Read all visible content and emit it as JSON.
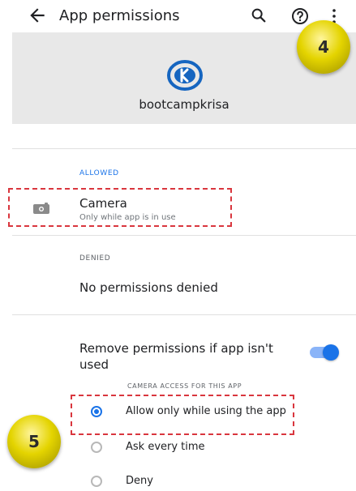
{
  "topbar": {
    "title": "App permissions",
    "icons": [
      "back-arrow-icon",
      "search-icon",
      "help-icon",
      "more-vert-icon"
    ]
  },
  "app": {
    "name": "bootcampkrisa",
    "logo_letter": "K",
    "logo_color": "#1565c0"
  },
  "allowed": {
    "label": "ALLOWED",
    "items": [
      {
        "title": "Camera",
        "subtitle": "Only while app is in use",
        "icon": "camera-icon"
      }
    ]
  },
  "denied": {
    "label": "DENIED",
    "empty_text": "No permissions denied"
  },
  "remove_permissions": {
    "text": "Remove permissions if app isn't used",
    "enabled": true
  },
  "camera_access": {
    "label": "CAMERA ACCESS FOR THIS APP",
    "options": [
      {
        "label": "Allow only while using the app",
        "selected": true
      },
      {
        "label": "Ask every time",
        "selected": false
      },
      {
        "label": "Deny",
        "selected": false
      }
    ]
  },
  "annotations": {
    "badge_4": "4",
    "badge_5": "5",
    "highlight_color": "#d9363e",
    "badge_color": "#e4d400"
  },
  "colors": {
    "accent": "#1a73e8",
    "header_bg": "#e8e8e8"
  }
}
